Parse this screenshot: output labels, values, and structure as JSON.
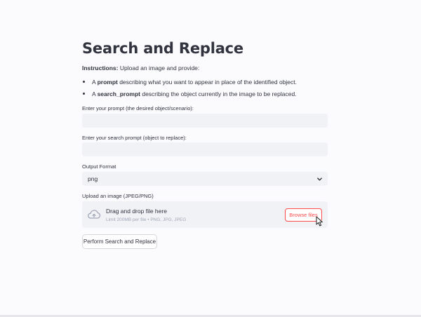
{
  "page": {
    "title": "Search and Replace",
    "instructions_prefix": "Instructions:",
    "instructions_text": "Upload an image and provide:",
    "bullets": [
      {
        "strong": "prompt",
        "pre": "A ",
        "post": " describing what you want to appear in place of the identified object."
      },
      {
        "strong": "search_prompt",
        "pre": "A ",
        "post": " describing the object currently in the image to be replaced."
      }
    ]
  },
  "form": {
    "prompt_label": "Enter your prompt (the desired object/scenario):",
    "prompt_value": "",
    "search_label": "Enter your search prompt (object to replace):",
    "search_value": "",
    "format_label": "Output Format",
    "format_value": "png",
    "upload_label": "Upload an image (JPEG/PNG)",
    "drop_title": "Drag and drop file here",
    "drop_limit": "Limit 200MB per file • PNG, JPG, JPEG",
    "browse_label": "Browse files",
    "submit_label": "Perform Search and Replace"
  },
  "colors": {
    "accent": "#ff4b4b",
    "input_bg": "#f0f2f6",
    "text": "#31333f"
  },
  "icons": {
    "upload": "cloud-upload-icon",
    "select": "chevron-down-icon",
    "pointer": "mouse-pointer-icon"
  }
}
